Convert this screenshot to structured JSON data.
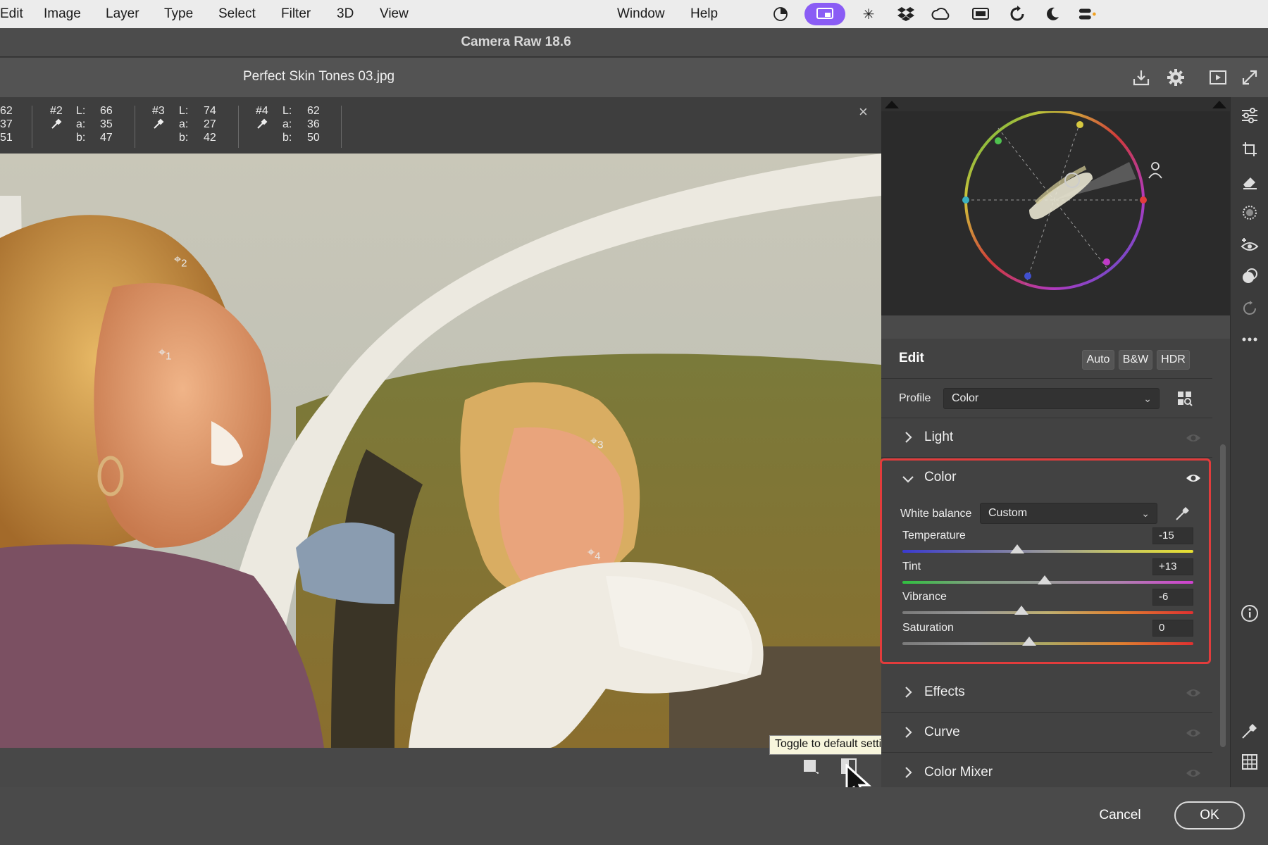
{
  "menubar": {
    "items": [
      "Edit",
      "Image",
      "Layer",
      "Type",
      "Select",
      "Filter",
      "3D",
      "View"
    ],
    "items_right": [
      "Window",
      "Help"
    ],
    "status_icons": [
      "color-wheel-icon",
      "screen-share-icon",
      "sparkle-icon",
      "dropbox-icon",
      "creative-cloud-icon",
      "display-icon",
      "refresh-icon",
      "moon-icon",
      "control-center-icon"
    ]
  },
  "window": {
    "title": "Camera Raw 18.6",
    "filename": "Perfect Skin Tones 03.jpg"
  },
  "readouts": {
    "partial": {
      "L": "62",
      "a": "37",
      "b": "51"
    },
    "samplers": [
      {
        "id": "#2",
        "L": "66",
        "a": "35",
        "b": "47"
      },
      {
        "id": "#3",
        "L": "74",
        "a": "27",
        "b": "42"
      },
      {
        "id": "#4",
        "L": "62",
        "a": "36",
        "b": "50"
      }
    ],
    "labels": {
      "L": "L:",
      "a": "a:",
      "b": "b:"
    },
    "close_glyph": "×"
  },
  "photo": {
    "samplers": [
      {
        "num": "2"
      },
      {
        "num": "1"
      },
      {
        "num": "3"
      },
      {
        "num": "4"
      }
    ]
  },
  "edit": {
    "title": "Edit",
    "auto_label": "Auto",
    "bw_label": "B&W",
    "hdr_label": "HDR",
    "profile_label": "Profile",
    "profile_value": "Color",
    "sections": {
      "light": "Light",
      "color": "Color",
      "effects": "Effects",
      "curve": "Curve",
      "color_mixer": "Color Mixer"
    },
    "white_balance_label": "White balance",
    "white_balance_value": "Custom",
    "sliders": [
      {
        "label": "Temperature",
        "value": "-15",
        "fraction": 0.395
      },
      {
        "label": "Tint",
        "value": "+13",
        "fraction": 0.49
      },
      {
        "label": "Vibrance",
        "value": "-6",
        "fraction": 0.41
      },
      {
        "label": "Saturation",
        "value": "0",
        "fraction": 0.437
      }
    ],
    "highlight_color": "#e23c3c"
  },
  "footer": {
    "cancel_label": "Cancel",
    "ok_label": "OK"
  },
  "tooltip": "Toggle to default settings (\\)"
}
